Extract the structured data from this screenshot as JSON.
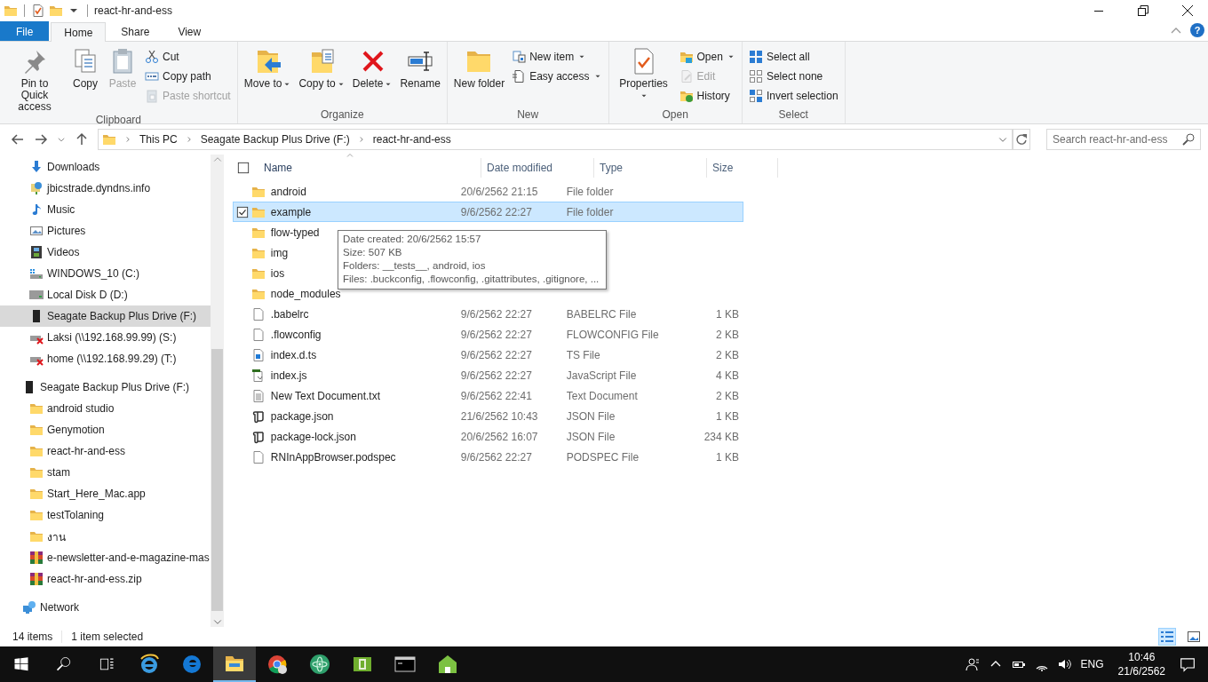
{
  "window": {
    "title": "react-hr-and-ess"
  },
  "ribbon_tabs": [
    {
      "label": "File",
      "kind": "backstage",
      "selected": false
    },
    {
      "label": "Home",
      "kind": "tab",
      "selected": true
    },
    {
      "label": "Share",
      "kind": "tab",
      "selected": false
    },
    {
      "label": "View",
      "kind": "tab",
      "selected": false
    }
  ],
  "help_button": "?",
  "ribbon_groups": [
    {
      "title": "Clipboard",
      "buttons": [
        {
          "label": "Pin to Quick access",
          "kind": "large",
          "disabled": false,
          "dropdown": false
        },
        {
          "label": "Copy",
          "kind": "large",
          "disabled": false,
          "dropdown": false
        },
        {
          "label": "Paste",
          "kind": "large",
          "disabled": true,
          "dropdown": false
        },
        {
          "label": "Cut",
          "kind": "small",
          "disabled": false,
          "dropdown": false
        },
        {
          "label": "Copy path",
          "kind": "small",
          "disabled": false,
          "dropdown": false
        },
        {
          "label": "Paste shortcut",
          "kind": "small",
          "disabled": true,
          "dropdown": false
        }
      ]
    },
    {
      "title": "Organize",
      "buttons": [
        {
          "label": "Move to",
          "kind": "large",
          "disabled": false,
          "dropdown": true
        },
        {
          "label": "Copy to",
          "kind": "large",
          "disabled": false,
          "dropdown": true
        },
        {
          "label": "Delete",
          "kind": "large",
          "disabled": false,
          "dropdown": true
        },
        {
          "label": "Rename",
          "kind": "large",
          "disabled": false,
          "dropdown": false
        }
      ]
    },
    {
      "title": "New",
      "buttons": [
        {
          "label": "New folder",
          "kind": "large",
          "disabled": false,
          "dropdown": false
        },
        {
          "label": "New item",
          "kind": "small",
          "disabled": false,
          "dropdown": true
        },
        {
          "label": "Easy access",
          "kind": "small",
          "disabled": false,
          "dropdown": true
        }
      ]
    },
    {
      "title": "Open",
      "buttons": [
        {
          "label": "Properties",
          "kind": "large",
          "disabled": false,
          "dropdown": true
        },
        {
          "label": "Open",
          "kind": "small",
          "disabled": false,
          "dropdown": true
        },
        {
          "label": "Edit",
          "kind": "small",
          "disabled": true,
          "dropdown": false
        },
        {
          "label": "History",
          "kind": "small",
          "disabled": false,
          "dropdown": false
        }
      ]
    },
    {
      "title": "Select",
      "buttons": [
        {
          "label": "Select all",
          "kind": "small",
          "disabled": false,
          "dropdown": false
        },
        {
          "label": "Select none",
          "kind": "small",
          "disabled": false,
          "dropdown": false
        },
        {
          "label": "Invert selection",
          "kind": "small",
          "disabled": false,
          "dropdown": false
        }
      ]
    }
  ],
  "address_bar": {
    "path": [
      "This PC",
      "Seagate Backup Plus Drive (F:)",
      "react-hr-and-ess"
    ]
  },
  "search": {
    "placeholder": "Search react-hr-and-ess"
  },
  "nav_pane": {
    "this_pc_items": [
      {
        "label": "Downloads",
        "kind": "downloads",
        "selected": false
      },
      {
        "label": "jbicstrade.dyndns.info",
        "kind": "website",
        "selected": false
      },
      {
        "label": "Music",
        "kind": "music",
        "selected": false
      },
      {
        "label": "Pictures",
        "kind": "pictures",
        "selected": false
      },
      {
        "label": "Videos",
        "kind": "videos",
        "selected": false
      },
      {
        "label": "WINDOWS_10 (C:)",
        "kind": "system-drive",
        "selected": false
      },
      {
        "label": "Local Disk D (D:)",
        "kind": "drive",
        "selected": false
      },
      {
        "label": "Seagate Backup Plus Drive (F:)",
        "kind": "external-drive",
        "selected": true
      },
      {
        "label": "Laksi (\\\\192.168.99.99) (S:)",
        "kind": "network-drive-offline",
        "selected": false
      },
      {
        "label": "home (\\\\192.168.99.29) (T:)",
        "kind": "network-drive-offline",
        "selected": false
      }
    ],
    "items": [
      {
        "label": "Seagate Backup Plus Drive (F:)",
        "kind": "external-drive",
        "selected": false,
        "children": [
          {
            "label": "android studio",
            "kind": "folder",
            "selected": false
          },
          {
            "label": "Genymotion",
            "kind": "folder",
            "selected": false
          },
          {
            "label": "react-hr-and-ess",
            "kind": "folder",
            "selected": false
          },
          {
            "label": "stam",
            "kind": "folder",
            "selected": false
          },
          {
            "label": "Start_Here_Mac.app",
            "kind": "folder",
            "selected": false
          },
          {
            "label": "testTolaning",
            "kind": "folder",
            "selected": false
          },
          {
            "label": "งาน",
            "kind": "folder",
            "selected": false
          },
          {
            "label": "e-newsletter-and-e-magazine-mas",
            "kind": "archive",
            "selected": false
          },
          {
            "label": "react-hr-and-ess.zip",
            "kind": "archive",
            "selected": false
          }
        ]
      },
      {
        "label": "Network",
        "kind": "network",
        "selected": false
      }
    ]
  },
  "file_list": {
    "select_all_checked": false,
    "columns": [
      {
        "label": "Name",
        "sorted": true
      },
      {
        "label": "Date modified",
        "sorted": false
      },
      {
        "label": "Type",
        "sorted": false
      },
      {
        "label": "Size",
        "sorted": false
      }
    ],
    "rows": [
      {
        "name": "android",
        "date": "20/6/2562 21:15",
        "type": "File folder",
        "kind": "folder",
        "selected": false
      },
      {
        "name": "example",
        "date": "9/6/2562 22:27",
        "type": "File folder",
        "kind": "folder",
        "selected": true
      },
      {
        "name": "flow-typed",
        "kind": "folder",
        "selected": false
      },
      {
        "name": "img",
        "kind": "folder",
        "selected": false
      },
      {
        "name": "ios",
        "kind": "folder",
        "selected": false
      },
      {
        "name": "node_modules",
        "kind": "folder",
        "selected": false
      },
      {
        "name": ".babelrc",
        "date": "9/6/2562 22:27",
        "type": "BABELRC File",
        "size": "1 KB",
        "kind": "file",
        "selected": false
      },
      {
        "name": ".flowconfig",
        "date": "9/6/2562 22:27",
        "type": "FLOWCONFIG File",
        "size": "2 KB",
        "kind": "file",
        "selected": false
      },
      {
        "name": "index.d.ts",
        "date": "9/6/2562 22:27",
        "type": "TS File",
        "size": "2 KB",
        "kind": "ts",
        "selected": false
      },
      {
        "name": "index.js",
        "date": "9/6/2562 22:27",
        "type": "JavaScript File",
        "size": "4 KB",
        "kind": "js",
        "selected": false
      },
      {
        "name": "New Text Document.txt",
        "date": "9/6/2562 22:41",
        "type": "Text Document",
        "size": "2 KB",
        "kind": "text",
        "selected": false
      },
      {
        "name": "package.json",
        "date": "21/6/2562 10:43",
        "type": "JSON File",
        "size": "1 KB",
        "kind": "json",
        "selected": false
      },
      {
        "name": "package-lock.json",
        "date": "20/6/2562 16:07",
        "type": "JSON File",
        "size": "234 KB",
        "kind": "json",
        "selected": false
      },
      {
        "name": "RNInAppBrowser.podspec",
        "date": "9/6/2562 22:27",
        "type": "PODSPEC File",
        "size": "1 KB",
        "kind": "file",
        "selected": false
      }
    ],
    "tooltip": {
      "lines": [
        "Date created: 20/6/2562 15:57",
        "Size: 507 KB",
        "Folders: __tests__, android, ios",
        "Files: .buckconfig, .flowconfig, .gitattributes, .gitignore, ..."
      ]
    }
  },
  "status_bar": {
    "item_count": "14 items",
    "selection": "1 item selected",
    "views": [
      {
        "kind": "details",
        "selected": true
      },
      {
        "kind": "large-icons",
        "selected": false
      }
    ]
  },
  "taskbar": {
    "apps": [
      {
        "kind": "internet-explorer",
        "selected": false
      },
      {
        "kind": "edge",
        "selected": false
      },
      {
        "kind": "explorer",
        "selected": true
      },
      {
        "kind": "chrome",
        "selected": false
      },
      {
        "kind": "atom",
        "selected": false
      },
      {
        "kind": "green-app",
        "selected": false
      },
      {
        "kind": "terminal",
        "selected": false
      },
      {
        "kind": "house-app",
        "selected": false
      }
    ],
    "language": "ENG",
    "time": "10:46",
    "date": "21/6/2562"
  }
}
